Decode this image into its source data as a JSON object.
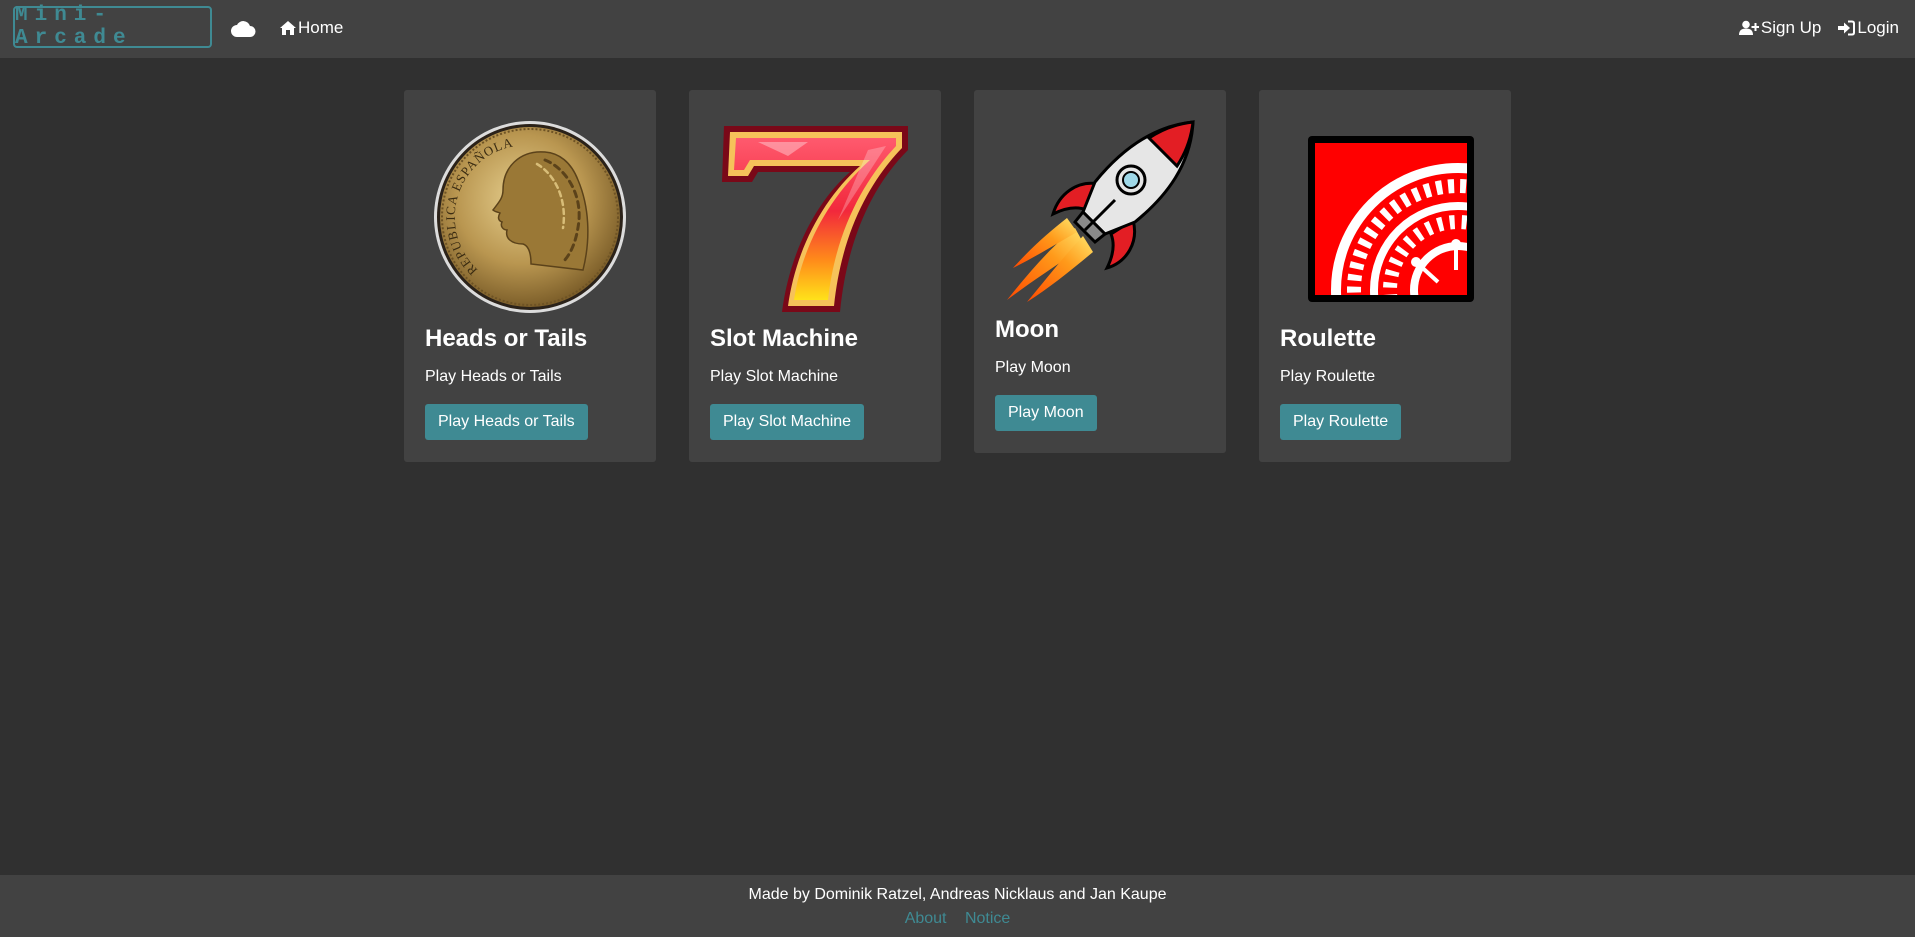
{
  "navbar": {
    "brand": "Mini-Arcade",
    "cloud_icon": "cloud-icon",
    "home_label": "Home",
    "signup_label": "Sign Up",
    "login_label": "Login"
  },
  "cards": [
    {
      "title": "Heads or Tails",
      "text": "Play Heads or Tails",
      "button": "Play Heads or Tails",
      "image": "coin-image",
      "coin_inscription": "REPUBLICA ESPAÑOLA"
    },
    {
      "title": "Slot Machine",
      "text": "Play Slot Machine",
      "button": "Play Slot Machine",
      "image": "seven-image"
    },
    {
      "title": "Moon",
      "text": "Play Moon",
      "button": "Play Moon",
      "image": "rocket-image"
    },
    {
      "title": "Roulette",
      "text": "Play Roulette",
      "button": "Play Roulette",
      "image": "roulette-image"
    }
  ],
  "footer": {
    "credit": "Made by Dominik Ratzel, Andreas Nicklaus and Jan Kaupe",
    "about": "About",
    "notice": "Notice"
  },
  "colors": {
    "background": "#303030",
    "surface": "#424242",
    "accent": "#3f8a93",
    "text": "#ffffff"
  }
}
